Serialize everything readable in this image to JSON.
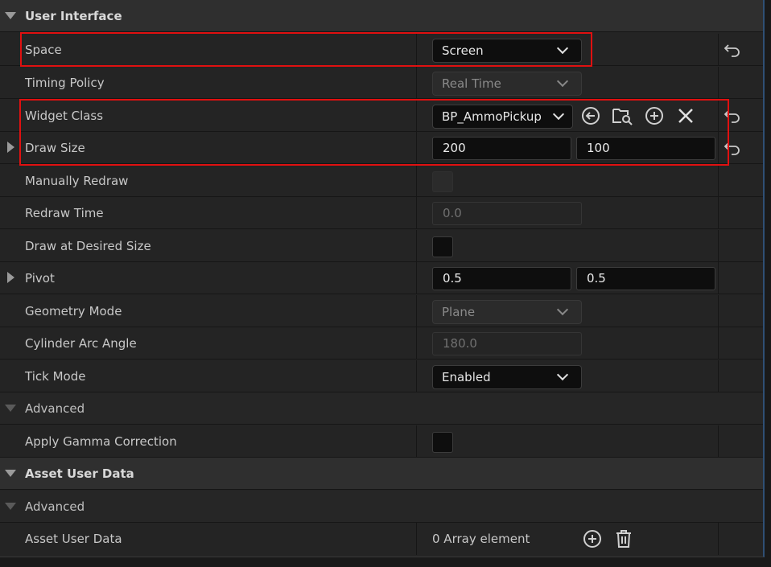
{
  "sections": {
    "user_interface": "User Interface",
    "advanced": "Advanced",
    "asset_user_data": "Asset User Data",
    "asset_advanced": "Advanced"
  },
  "props": {
    "space": {
      "label": "Space",
      "value": "Screen"
    },
    "timing_policy": {
      "label": "Timing Policy",
      "value": "Real Time"
    },
    "widget_class": {
      "label": "Widget Class",
      "value": "BP_AmmoPickup"
    },
    "draw_size": {
      "label": "Draw Size",
      "x": "200",
      "y": "100"
    },
    "manually_redraw": {
      "label": "Manually Redraw"
    },
    "redraw_time": {
      "label": "Redraw Time",
      "value": "0.0"
    },
    "draw_at_desired_size": {
      "label": "Draw at Desired Size"
    },
    "pivot": {
      "label": "Pivot",
      "x": "0.5",
      "y": "0.5"
    },
    "geometry_mode": {
      "label": "Geometry Mode",
      "value": "Plane"
    },
    "cylinder_arc_angle": {
      "label": "Cylinder Arc Angle",
      "value": "180.0"
    },
    "tick_mode": {
      "label": "Tick Mode",
      "value": "Enabled"
    },
    "apply_gamma_correction": {
      "label": "Apply Gamma Correction"
    },
    "asset_user_data": {
      "label": "Asset User Data",
      "value": "0 Array element"
    }
  },
  "colors": {
    "highlight": "#e01010",
    "panel_bg": "#242424",
    "header_bg": "#2f2f2f"
  }
}
